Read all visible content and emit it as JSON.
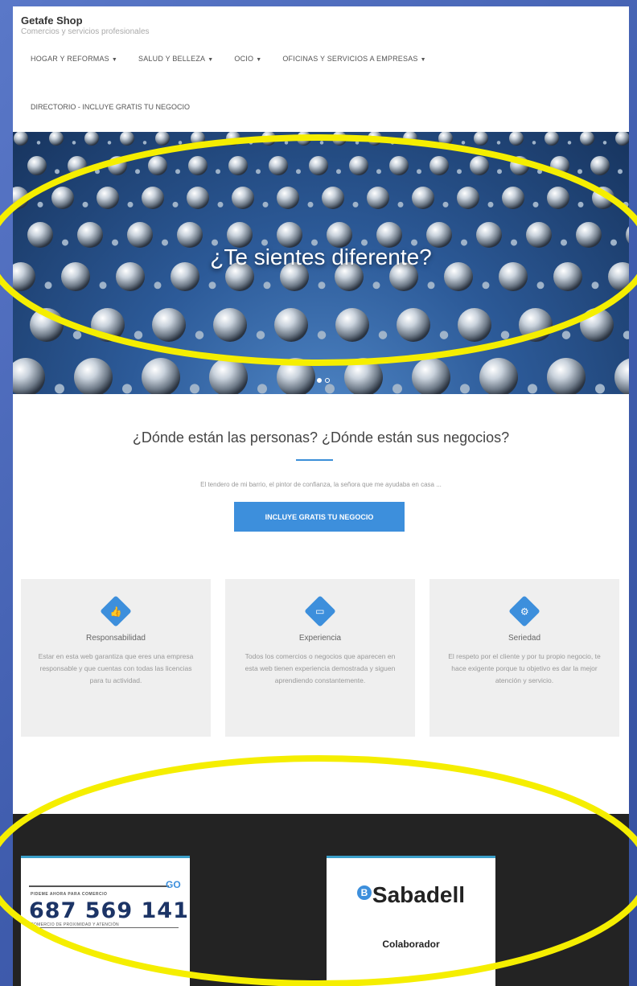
{
  "header": {
    "title": "Getafe Shop",
    "tagline": "Comercios y servicios profesionales"
  },
  "nav": {
    "items": [
      {
        "label": "HOGAR Y REFORMAS"
      },
      {
        "label": "SALUD Y BELLEZA"
      },
      {
        "label": "OCIO"
      },
      {
        "label": "OFICINAS Y SERVICIOS A EMPRESAS"
      }
    ],
    "caret": "▼",
    "directory": "DIRECTORIO - INCLUYE GRATIS TU NEGOCIO"
  },
  "hero": {
    "headline": "¿Te sientes diferente?",
    "slides": 2,
    "active_slide": 1
  },
  "intro": {
    "title": "¿Dónde están las personas? ¿Dónde están sus negocios?",
    "subtitle": "El tendero de mi barrio, el pintor de confianza, la señora que me ayudaba en casa ...",
    "cta": "INCLUYE GRATIS TU NEGOCIO"
  },
  "features": [
    {
      "icon": "thumbs-up-icon",
      "glyph": "👍",
      "title": "Responsabilidad",
      "text": "Estar en esta web garantiza que eres una empresa responsable y que cuentas con todas las licencias para tu actividad."
    },
    {
      "icon": "monitor-icon",
      "glyph": "▭",
      "title": "Experiencia",
      "text": "Todos los comercios o negocios que aparecen en esta web tienen experiencia demostrada y siguen aprendiendo constantemente."
    },
    {
      "icon": "cogs-icon",
      "glyph": "⚙",
      "title": "Seriedad",
      "text": "El respeto por el cliente y por tu propio negocio, te hace exigente porque tu objetivo es dar la mejor atención y servicio."
    }
  ],
  "footer": {
    "ad": {
      "logo": "GO",
      "small_line": "PIDEME AHORA PARA COMERCIO",
      "phone": "687 569 141",
      "small_line2": "COMERCIO DE PROXIMIDAD Y ATENCIÓN"
    },
    "partner": {
      "logo_letter": "B",
      "logo": "Sabadell",
      "caption": "Colaborador"
    }
  },
  "colors": {
    "accent": "#3d8fdc",
    "annotation": "#f5ee00",
    "footer_bg": "#232323"
  }
}
